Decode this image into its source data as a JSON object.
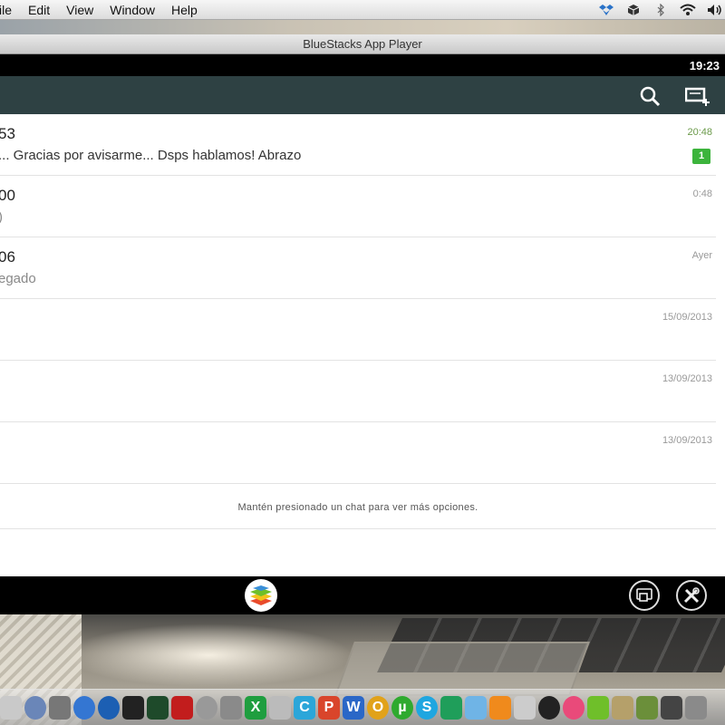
{
  "menubar": {
    "items": [
      "ile",
      "Edit",
      "View",
      "Window",
      "Help"
    ]
  },
  "window": {
    "title": "BlueStacks App Player"
  },
  "statusbar": {
    "time": "19:23"
  },
  "actionbar": {
    "icons": [
      "search-icon",
      "new-chat-icon"
    ]
  },
  "chats": [
    {
      "name": "53",
      "message": "... Gracias por avisarme... Dsps hablamos! Abrazo",
      "time": "20:48",
      "unread": "1"
    },
    {
      "name": "00",
      "message": ")",
      "time": "0:48"
    },
    {
      "name": "06",
      "message": "egado",
      "time": "Ayer"
    },
    {
      "name": "",
      "message": "",
      "time": "15/09/2013"
    },
    {
      "name": "",
      "message": "",
      "time": "13/09/2013"
    },
    {
      "name": "",
      "message": "",
      "time": "13/09/2013"
    }
  ],
  "hint": "Mantén presionado un chat para ver más opciones.",
  "colors": {
    "action_bar": "#2e4143",
    "unread_badge": "#3cb43c"
  }
}
